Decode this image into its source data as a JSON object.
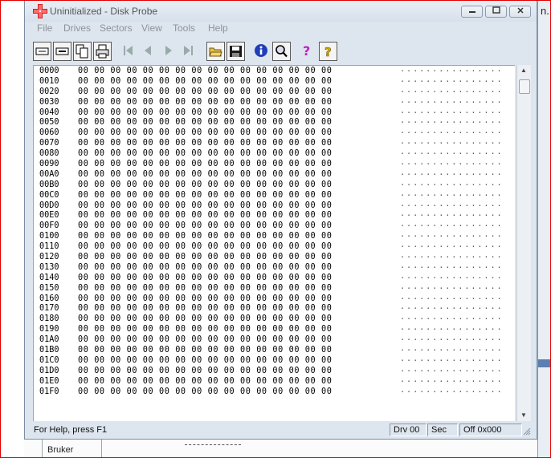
{
  "window": {
    "title": "Uninitialized - Disk Probe",
    "caption_buttons": [
      "minimize-button",
      "maximize-button",
      "close-button"
    ]
  },
  "menu": [
    "File",
    "Drives",
    "Sectors",
    "View",
    "Tools",
    "Help"
  ],
  "toolbar": {
    "buttons": [
      "read-sector-icon",
      "write-sector-icon",
      "copy-icon",
      "print-icon",
      "first-sector-icon",
      "previous-sector-icon",
      "next-sector-icon",
      "last-sector-icon",
      "open-file-icon",
      "save-file-icon",
      "info-icon",
      "search-icon",
      "help-icon",
      "context-help-icon"
    ]
  },
  "hex_view": {
    "addresses": [
      "0000",
      "0010",
      "0020",
      "0030",
      "0040",
      "0050",
      "0060",
      "0070",
      "0080",
      "0090",
      "00A0",
      "00B0",
      "00C0",
      "00D0",
      "00E0",
      "00F0",
      "0100",
      "0110",
      "0120",
      "0130",
      "0140",
      "0150",
      "0160",
      "0170",
      "0180",
      "0190",
      "01A0",
      "01B0",
      "01C0",
      "01D0",
      "01E0",
      "01F0"
    ],
    "bytes_per_row": "00 00 00 00 00 00 00 00 00 00 00 00 00 00 00 00",
    "ascii_per_row": "................"
  },
  "status": {
    "help_text": "For Help, press F1",
    "drive": "Drv  00",
    "sector": "Sec",
    "offset": "Off 0x000"
  },
  "background": {
    "right_edge_text": "n.",
    "bottom_cell_text": "Bruker"
  }
}
